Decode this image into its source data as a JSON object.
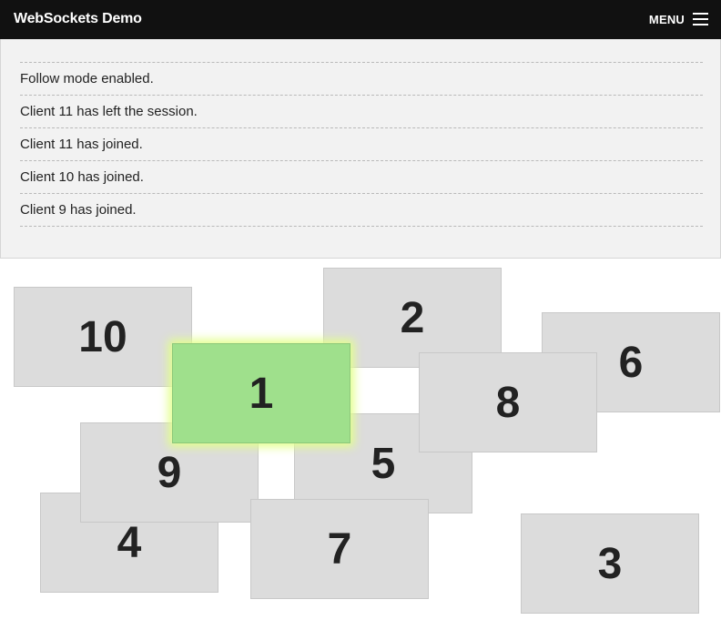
{
  "header": {
    "title": "WebSockets Demo",
    "menu_label": "MENU"
  },
  "log": [
    "Follow mode enabled.",
    "Client 11 has left the session.",
    "Client 11 has joined.",
    "Client 10 has joined.",
    "Client 9 has joined."
  ],
  "clients": {
    "c10": "10",
    "c2": "2",
    "c6": "6",
    "c8": "8",
    "c5": "5",
    "c4": "4",
    "c9": "9",
    "c1": "1",
    "c7": "7",
    "c3": "3"
  },
  "active_client": "1",
  "colors": {
    "topbar": "#111111",
    "card": "#dcdcdc",
    "active_card": "#9fe08c",
    "active_glow": "#e2ff8a"
  }
}
